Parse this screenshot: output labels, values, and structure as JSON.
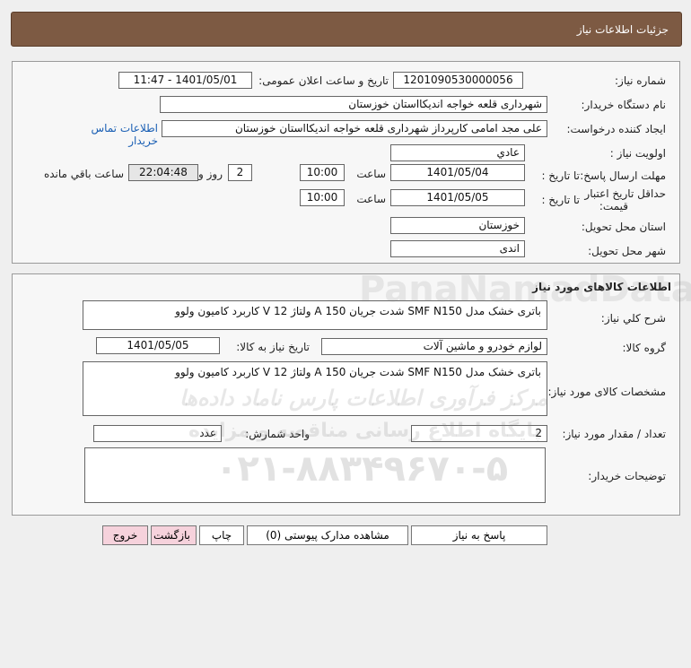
{
  "header": {
    "title": "جزئیات اطلاعات نیاز"
  },
  "info": {
    "need_number_label": "شماره نیاز:",
    "need_number": "1201090530000056",
    "announce_label": "تاریخ و ساعت اعلان عمومی:",
    "announce_value": "1401/05/01 - 11:47",
    "buyer_org_label": "نام دستگاه خریدار:",
    "buyer_org": "شهرداری قلعه خواجه اندیکااستان خوزستان",
    "requester_label": "ایجاد کننده درخواست:",
    "requester": "علی مجد امامی کارپرداز شهرداری قلعه خواجه اندیکااستان خوزستان",
    "contact_link": "اطلاعات تماس خریدار",
    "priority_label": "اولویت نیاز :",
    "priority": "عادي",
    "deadline_label": "مهلت ارسال پاسخ:",
    "until_date_label": "تا تاریخ :",
    "deadline_date": "1401/05/04",
    "time_label": "ساعت",
    "deadline_time": "10:00",
    "days_value": "2",
    "days_label": "روز و",
    "remaining_time": "22:04:48",
    "remaining_label": "ساعت باقي مانده",
    "validity_label_1": "حداقل تاریخ اعتبار",
    "validity_label_2": "قیمت:",
    "validity_until_label": "تا تاریخ :",
    "validity_date": "1401/05/05",
    "validity_time_label": "ساعت",
    "validity_time": "10:00",
    "province_label": "استان محل تحویل:",
    "province": "خوزستان",
    "city_label": "شهر محل تحویل:",
    "city": "اندی"
  },
  "goods": {
    "section_title": "اطلاعات کالاهای مورد نیاز",
    "general_desc_label": "شرح کلي نیاز:",
    "general_desc": "باتری خشک مدل SMF N150 شدت جریان 150 A ولتاژ 12 V کاربرد کامیون ولوو",
    "group_label": "گروه کالا:",
    "group": "لوازم خودرو و ماشین آلات",
    "need_date_label": "تاریخ نیاز به کالا:",
    "need_date": "1401/05/05",
    "specs_label": "مشخصات کالای مورد نیاز:",
    "specs": "باتری خشک مدل SMF N150 شدت جریان 150 A ولتاژ 12 V کاربرد کامیون ولوو",
    "qty_label": "تعداد / مقدار مورد نیاز:",
    "qty": "2",
    "unit_label": "واحد شمارش:",
    "unit": "عدد",
    "buyer_notes_label": "توضیحات خریدار:",
    "buyer_notes": ""
  },
  "buttons": {
    "reply": "پاسخ به نیاز",
    "attachments": "مشاهده مدارک پیوستی (0)",
    "print": "چاپ",
    "back": "بازگشت",
    "exit": "خروج"
  },
  "watermark": {
    "top": "PanaNamadData",
    "line1": "مرکز فرآوری اطلاعات پارس ناماد داده‌ها",
    "line2": "پایگاه اطلاع رسانی مناقصه و مزایده",
    "phone": "۰۲۱-۸۸۳۴۹۶۷۰-۵"
  }
}
